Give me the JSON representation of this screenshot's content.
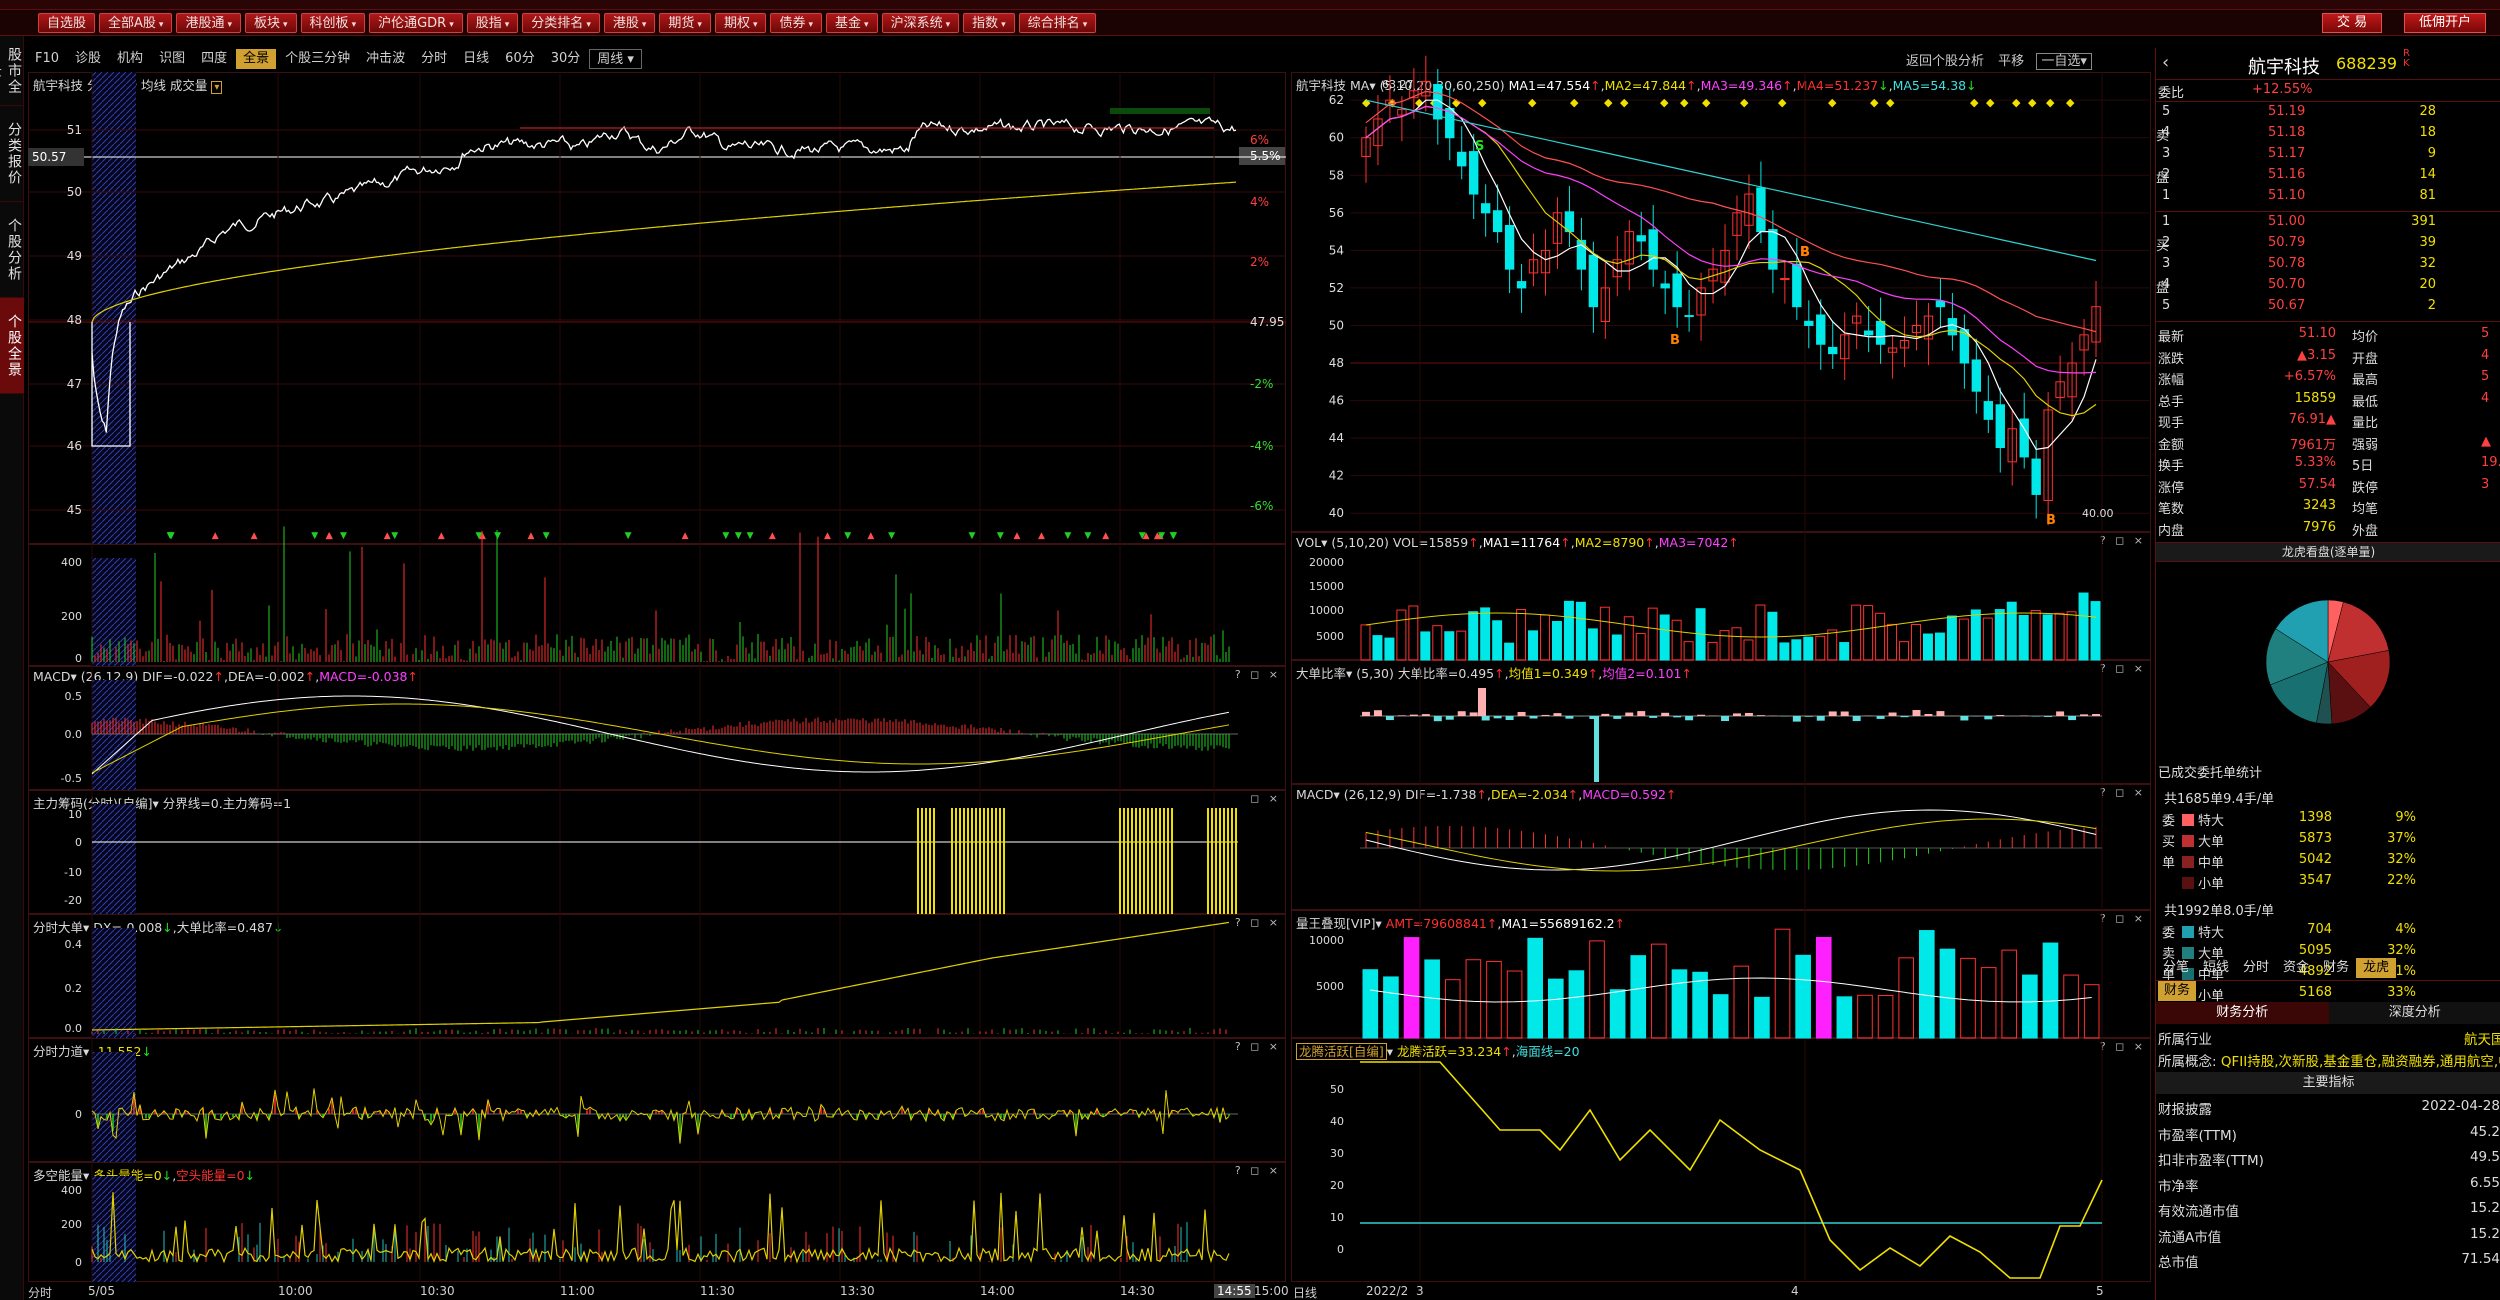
{
  "menu": [
    "自选股",
    "全部A股",
    "港股通",
    "板块",
    "科创板",
    "沪伦通GDR",
    "股指",
    "分类排名",
    "港股",
    "期货",
    "期权",
    "债券",
    "基金",
    "沪深系统",
    "指数",
    "综合排名"
  ],
  "topright": {
    "trade": "交 易",
    "open_account": "低佣开户"
  },
  "sidebar": [
    "股市全景",
    "分类报价",
    "个股分析",
    "个股全景"
  ],
  "left": {
    "tabs": [
      "F10",
      "诊股",
      "机构",
      "识图",
      "四度",
      "全景",
      "个股三分钟",
      "冲击波",
      "分时",
      "日线",
      "60分",
      "30分",
      "周线"
    ],
    "main_title": "航宇科技 分时走势 均线 成交量",
    "price_ticks": [
      "51",
      "50",
      "49",
      "48",
      "47",
      "46",
      "45"
    ],
    "pct_ticks": [
      "6%",
      "5.5%",
      "4%",
      "2%",
      "-2%",
      "-4%",
      "-6%"
    ],
    "price_label": "50.57",
    "prev_close": "47.95",
    "macd_title": "MACD",
    "macd_params": "(26,12,9)",
    "macd_dif": "DIF=-0.022",
    "macd_dea": "DEA=-0.002",
    "macd_val": "MACD=-0.038",
    "chip_title": "主力筹码(分时)[自编]",
    "chip_desc": "分界线=0.主力筹码=1",
    "big_title": "分时大单",
    "big_desc": "DX=-0.008",
    "big_desc2": "大单比率=0.487",
    "force_title": "分时力道",
    "force_val": "-11.552",
    "energy_title": "多空能量",
    "energy_desc": "多头量能=0",
    "energy_desc2": "空头能量=0",
    "time_ticks": [
      "分时",
      "5/05",
      "10:00",
      "10:30",
      "11:00",
      "11:30",
      "13:30",
      "14:00",
      "14:30",
      "14:55",
      "15:00"
    ],
    "vol_ticks": [
      "400",
      "200",
      "0"
    ],
    "macd_ticks": [
      "0.5",
      "0.0",
      "-0.5"
    ],
    "chip_ticks": [
      "10",
      "0",
      "-10",
      "-20"
    ],
    "big_ticks": [
      "0.4",
      "0.2",
      "0.0"
    ],
    "force_ticks": [
      "0"
    ],
    "energy_ticks": [
      "400",
      "200",
      "0"
    ]
  },
  "mid": {
    "back": "返回个股分析",
    "flat": "平移",
    "watch": "一自选",
    "title": "航宇科技",
    "ma": "MA",
    "ma_params": "(5,10,20,30,60,250)",
    "ma1": "MA1=47.554",
    "ma2": "MA2=47.844",
    "ma3": "MA3=49.346",
    "ma4": "MA4=51.237",
    "ma5": "MA5=54.38",
    "price_ticks": [
      "62",
      "60",
      "58",
      "56",
      "54",
      "52",
      "50",
      "48",
      "46",
      "44",
      "42",
      "40"
    ],
    "high_label": "63.27",
    "low_label": "40.00",
    "vol_title": "VOL",
    "vol_params": "(5,10,20)",
    "vol_v": "VOL=15859",
    "vol_ma1": "MA1=11764",
    "vol_ma2": "MA2=8790",
    "vol_ma3": "MA3=7042",
    "vol_ticks": [
      "20000",
      "15000",
      "10000",
      "5000"
    ],
    "bigratio_title": "大单比率",
    "bigratio_params": "(5,30)",
    "bigratio_v": "大单比率=0.495",
    "bigratio_m1": "均值1=0.349",
    "bigratio_m2": "均值2=0.101",
    "macd_title": "MACD",
    "macd_params": "(26,12,9)",
    "macd_dif": "DIF=-1.738",
    "macd_dea": "DEA=-2.034",
    "macd_val": "MACD=0.592",
    "vip_title": "量王叠现[VIP]",
    "vip_amt": "AMT=79608841",
    "vip_ma1": "MA1=55689162.2",
    "vip_ticks": [
      "10000",
      "5000"
    ],
    "dragon_title": "龙腾活跃[自编]",
    "dragon_v": "龙腾活跃=33.234",
    "dragon_sea": "海面线=20",
    "dragon_ticks": [
      "50",
      "40",
      "30",
      "20",
      "10",
      "0"
    ],
    "date_ticks": [
      "日线",
      "2022/2",
      "3",
      "4",
      "5"
    ]
  },
  "right": {
    "name": "航宇科技",
    "code": "688239",
    "flags": "R K",
    "webi_label": "委比",
    "webi": "+12.55%",
    "sells": [
      {
        "lv": "5",
        "p": "51.19",
        "v": "28"
      },
      {
        "lv": "4",
        "p": "51.18",
        "v": "18"
      },
      {
        "lv": "3",
        "p": "51.17",
        "v": "9"
      },
      {
        "lv": "2",
        "p": "51.16",
        "v": "14"
      },
      {
        "lv": "1",
        "p": "51.10",
        "v": "81"
      }
    ],
    "buys": [
      {
        "lv": "1",
        "p": "51.00",
        "v": "391"
      },
      {
        "lv": "2",
        "p": "50.79",
        "v": "39"
      },
      {
        "lv": "3",
        "p": "50.78",
        "v": "32"
      },
      {
        "lv": "4",
        "p": "50.70",
        "v": "20"
      },
      {
        "lv": "5",
        "p": "50.67",
        "v": "2"
      }
    ],
    "sell_side": "卖",
    "buy_side": "买",
    "disk": "盘",
    "quote": [
      [
        "最新",
        "51.10",
        "均价",
        "5"
      ],
      [
        "涨跌",
        "▲3.15",
        "开盘",
        "4"
      ],
      [
        "涨幅",
        "+6.57%",
        "最高",
        "5"
      ],
      [
        "总手",
        "15859",
        "最低",
        "4"
      ],
      [
        "现手",
        "76.91▲",
        "量比",
        ""
      ],
      [
        "金额",
        "7961万",
        "强弱",
        "▲"
      ],
      [
        "换手",
        "5.33%",
        "5日",
        "19."
      ],
      [
        "涨停",
        "57.54",
        "跌停",
        "3"
      ],
      [
        "笔数",
        "3243",
        "均笔",
        ""
      ],
      [
        "内盘",
        "7976",
        "外盘",
        ""
      ]
    ],
    "pie_title": "龙虎看盘(逐单量)",
    "order_stat": "已成交委托单统计",
    "buy_total": "共1685单9.4手/单",
    "buy_rows": [
      [
        "特大",
        "1398",
        "9%"
      ],
      [
        "大单",
        "5873",
        "37%"
      ],
      [
        "中单",
        "5042",
        "32%"
      ],
      [
        "小单",
        "3547",
        "22%"
      ]
    ],
    "sell_total": "共1992单8.0手/单",
    "sell_rows": [
      [
        "特大",
        "704",
        "4%"
      ],
      [
        "大单",
        "5095",
        "32%"
      ],
      [
        "中单",
        "4892",
        "31%"
      ],
      [
        "小单",
        "5168",
        "33%"
      ]
    ],
    "buy_side_labels": [
      "委",
      "买",
      "单"
    ],
    "sell_side_labels": [
      "委",
      "卖",
      "单"
    ],
    "info_tabs": [
      "分笔",
      "短线",
      "分时",
      "资金",
      "财务",
      "龙虎"
    ],
    "fin_tab": "财务",
    "fin_analysis": "财务分析",
    "deep_analysis": "深度分析",
    "industry_label": "所属行业",
    "industry": "航天国",
    "concept_label": "所属概念",
    "concept": "QFII持股,次新股,基金重仓,融资融券,通用航空,中",
    "main_index": "主要指标",
    "fin_rows": [
      [
        "财报披露",
        "2022-04-28"
      ],
      [
        "市盈率(TTM)",
        "45.2"
      ],
      [
        "扣非市盈率(TTM)",
        "49.5"
      ],
      [
        "市净率",
        "6.55"
      ],
      [
        "有效流通市值",
        "15.2"
      ],
      [
        "流通A市值",
        "15.2"
      ],
      [
        "总市值",
        "71.54"
      ]
    ],
    "colors": {
      "up": "#ff3030",
      "down": "#00e0e0",
      "yellow": "#f0e000"
    }
  }
}
